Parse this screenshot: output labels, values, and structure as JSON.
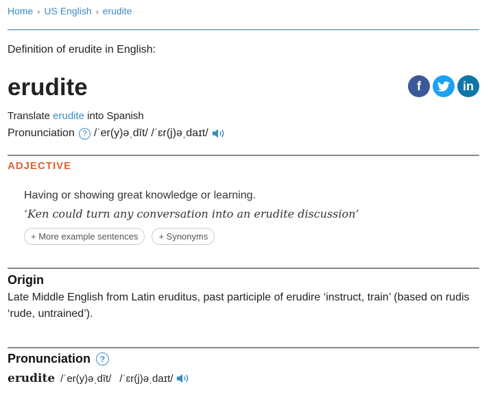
{
  "breadcrumb": {
    "home": "Home",
    "section": "US English",
    "current": "erudite"
  },
  "definition_of": "Definition of erudite in English:",
  "headword": "erudite",
  "social": {
    "facebook": "f",
    "twitter": "t",
    "linkedin": "in"
  },
  "translate": {
    "prefix": "Translate ",
    "word": "erudite",
    "suffix": " into Spanish"
  },
  "pronunciation_line": {
    "label": "Pronunciation",
    "help": "?",
    "ipa": "/ˈer(y)əˌdīt/ /ˈɛr(j)əˌdaɪt/"
  },
  "part_of_speech": "ADJECTIVE",
  "sense": {
    "definition": "Having or showing great knowledge or learning.",
    "example": "‘Ken could turn any conversation into an erudite discussion’",
    "more_examples": "+ More example sentences",
    "synonyms": "+ Synonyms"
  },
  "origin": {
    "heading": "Origin",
    "text": "Late Middle English from Latin eruditus, past participle of erudire ‘instruct, train’ (based on rudis ‘rude, untrained’)."
  },
  "pronunciation_section": {
    "heading": "Pronunciation",
    "help": "?",
    "word": "erudite",
    "ipa_us": "/ˈer(y)əˌdīt/",
    "ipa_ipa": "/ˈɛr(j)əˌdaɪt/"
  },
  "colors": {
    "link": "#3a8bc4",
    "pos": "#e06030",
    "facebook": "#3b5998",
    "twitter": "#1da1f2",
    "linkedin": "#0e76a8"
  }
}
